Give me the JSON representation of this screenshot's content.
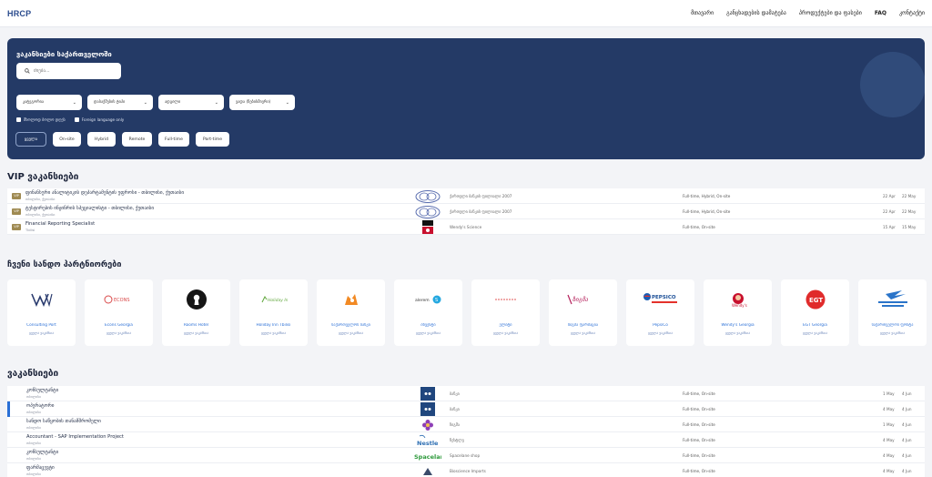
{
  "nav": {
    "logo": "HRCP",
    "links": [
      "მთავარი",
      "განცხადების დამატება",
      "პროდუქტები და ფასები",
      "FAQ",
      "კონტაქტი"
    ]
  },
  "hero": {
    "title": "ვაკანსიები საქართველოში",
    "search_placeholder": "ძიება...",
    "filters": [
      "კატეგორია",
      "დასაქმების ტიპი",
      "ადგილი",
      "ვადა (ნებისმიერი)"
    ],
    "checkboxes": [
      "მხოლოდ ბოლო დღეს",
      "Foreign language only"
    ],
    "chips": [
      "ყველა",
      "On-site",
      "Hybrid",
      "Remote",
      "Full-time",
      "Part-time"
    ],
    "active_chip": "ყველა"
  },
  "vip": {
    "title": "VIP ვაკანსიები",
    "badge": "VIP",
    "rows": [
      {
        "title": "ფინანსური ანალიტიკის დეპარტამენტის უფროსი - თბილისი, ქუთაისი",
        "location": "თბილისი, ქუთაისი",
        "company": "ქართული ბანკის ფილიალი 2007",
        "work_type": "Full-time, Hybrid, On-site",
        "posted": "22 Apr",
        "deadline": "22 May"
      },
      {
        "title": "ტესტირების ინჟინრის სპეციალისტი - თბილისი, ქუთაისი",
        "location": "თბილისი, ქუთაისი",
        "company": "ქართული ბანკის ფილიალი 2007",
        "work_type": "Full-time, Hybrid, On-site",
        "posted": "22 Apr",
        "deadline": "22 May"
      },
      {
        "title": "Financial Reporting Specialist",
        "location": "Tbilisi",
        "company": "Wendy's Science",
        "work_type": "Full-time, On-site",
        "posted": "15 Apr",
        "deadline": "15 May"
      }
    ]
  },
  "partners": {
    "title": "ჩვენი სანდო პარტნიორები",
    "link_label": "ყველა ვაკანსია",
    "items": [
      {
        "name": "Consulting Port",
        "logo": "W"
      },
      {
        "name": "Econs Georgia",
        "logo": "ECONS"
      },
      {
        "name": "Rooms Hotel",
        "logo": "keyhole"
      },
      {
        "name": "Holiday Inn Tbilisi",
        "logo": "Holiday Inn"
      },
      {
        "name": "საქართველოს ბანკი",
        "logo": "orange-mark"
      },
      {
        "name": "ინვესტი",
        "logo": "alerem"
      },
      {
        "name": "ელიტი",
        "logo": "elite"
      },
      {
        "name": "ზიგმა ფარმაცია",
        "logo": "ზიგმა"
      },
      {
        "name": "PepsiCo",
        "logo": "PEPSICO"
      },
      {
        "name": "Wendy's Georgia",
        "logo": "wendys"
      },
      {
        "name": "EGT Georgia",
        "logo": "EGT"
      },
      {
        "name": "საქართველოს ფოსტა",
        "logo": "საქართველოს ფოსტა"
      }
    ]
  },
  "jobs": {
    "title": "ვაკანსიები",
    "rows": [
      {
        "title": "კონსულტანტი",
        "location": "თბილისი",
        "company": "ბანკი",
        "work_type": "Full-time, On-site",
        "posted": "1 May",
        "deadline": "4 Jun"
      },
      {
        "title": "ოპერატორი",
        "location": "თბილისი",
        "company": "ბანკი",
        "work_type": "Full-time, On-site",
        "posted": "4 May",
        "deadline": "4 Jun"
      },
      {
        "title": "სანდო საწყობის თანამშრომელი",
        "location": "თბილისი",
        "company": "ზიგმა",
        "work_type": "Full-time, On-site",
        "posted": "1 May",
        "deadline": "4 Jun"
      },
      {
        "title": "Accountant - SAP Implementation Project",
        "location": "თბილისი",
        "company": "ნესტლე",
        "work_type": "Full-time, On-site",
        "posted": "4 May",
        "deadline": "4 Jun"
      },
      {
        "title": "კონსულტანტი",
        "location": "თბილისი",
        "company": "Spacelane shop",
        "work_type": "Full-time, On-site",
        "posted": "4 May",
        "deadline": "4 Jun"
      },
      {
        "title": "ფარმაცევტი",
        "location": "თბილისი",
        "company": "Bioscience Imports",
        "work_type": "Full-time, On-site",
        "posted": "4 May",
        "deadline": "4 Jun"
      }
    ]
  },
  "colors": {
    "hero_bg": "#243a66",
    "accent": "#2a6fd6",
    "vip_badge": "#9f8a52"
  }
}
